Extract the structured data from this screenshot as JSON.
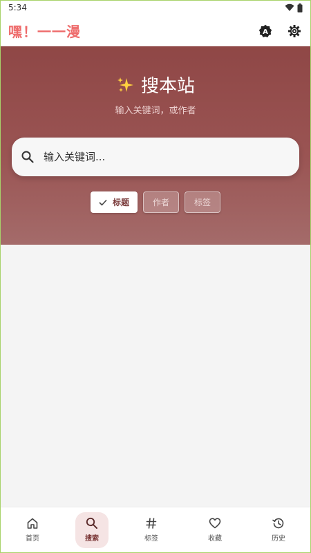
{
  "status_bar": {
    "time": "5:34"
  },
  "app_bar": {
    "title": "嘿！一一漫",
    "translate_icon": "translate-a-icon",
    "settings_icon": "gear-icon"
  },
  "hero": {
    "title": "搜本站",
    "title_icon": "sparkles-icon",
    "subtitle": "输入关键词，或作者",
    "search": {
      "placeholder": "输入关键词...",
      "value": ""
    },
    "filters": [
      {
        "label": "标题",
        "selected": true
      },
      {
        "label": "作者",
        "selected": false
      },
      {
        "label": "标签",
        "selected": false
      }
    ]
  },
  "bottom_nav": [
    {
      "label": "首页",
      "icon": "home-icon",
      "active": false
    },
    {
      "label": "搜索",
      "icon": "search-icon",
      "active": true
    },
    {
      "label": "标签",
      "icon": "hash-icon",
      "active": false
    },
    {
      "label": "收藏",
      "icon": "heart-icon",
      "active": false
    },
    {
      "label": "历史",
      "icon": "history-icon",
      "active": false
    }
  ],
  "colors": {
    "accent": "#ee6b6b",
    "hero_bg": "#924a49",
    "active_nav_bg": "#f5e4e4"
  }
}
